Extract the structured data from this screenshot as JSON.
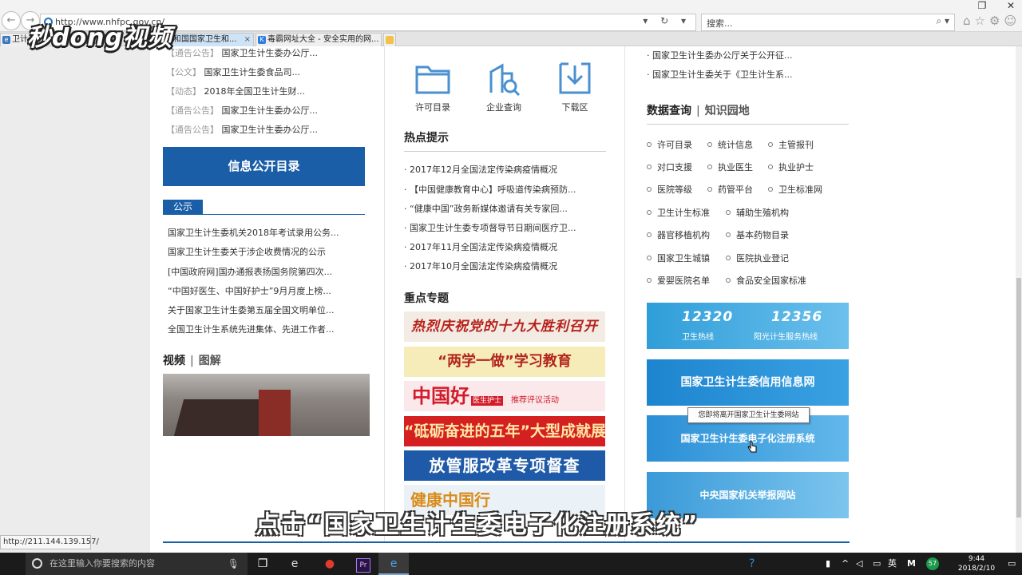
{
  "browser": {
    "url": "http://www.nhfpc.gov.cn/",
    "search_placeholder": "搜索...",
    "tabs": [
      {
        "label": "卫计..."
      },
      {
        "label": "共和国国家卫生和..."
      },
      {
        "label": "毒霸网址大全 - 安全实用的网..."
      }
    ]
  },
  "watermark_logo": "秒dong视频",
  "left_column": {
    "top_items": [
      {
        "tag": "【通告公告】",
        "text": "国家卫生计生委办公厅..."
      },
      {
        "tag": "【公文】",
        "text": "国家卫生计生委食品司..."
      },
      {
        "tag": "【动态】",
        "text": "2018年全国卫生计生财..."
      },
      {
        "tag": "【通告公告】",
        "text": "国家卫生计生委办公厅..."
      },
      {
        "tag": "【通告公告】",
        "text": "国家卫生计生委办公厅..."
      }
    ],
    "catalog_button": "信息公开目录",
    "notice_tab": "公示",
    "notice_items": [
      "国家卫生计生委机关2018年考试录用公务...",
      "国家卫生计生委关于涉企收费情况的公示",
      "[中国政府网]国办通报表扬国务院第四次...",
      "“中国好医生、中国好护士”9月月度上榜...",
      "关于国家卫生计生委第五届全国文明单位...",
      "全国卫生计生系统先进集体、先进工作者..."
    ],
    "video_head": "视频",
    "video_sub": "图解"
  },
  "middle_column": {
    "quick_links": [
      {
        "label": "许可目录"
      },
      {
        "label": "企业查询"
      },
      {
        "label": "下载区"
      }
    ],
    "hot_head": "热点提示",
    "hot_items": [
      "2017年12月全国法定传染病疫情概况",
      "【中国健康教育中心】呼吸道传染病预防...",
      "“健康中国”政务新媒体邀请有关专家回...",
      "国家卫生计生委专项督导节日期间医疗卫...",
      "2017年11月全国法定传染病疫情概况",
      "2017年10月全国法定传染病疫情概况"
    ],
    "topics_head": "重点专题",
    "banners": [
      "热烈庆祝党的十九大胜利召开",
      "“两学一做”学习教育",
      "中国好",
      "“砥砺奋进的五年”大型成就展",
      "放管服改革专项督查",
      "健康中国行"
    ],
    "banner3_badge": "医生护士",
    "banner3_small": "推荐评议活动"
  },
  "right_column": {
    "top_items": [
      "国家卫生计生委办公厅关于公开征...",
      "国家卫生计生委关于《卫生计生系..."
    ],
    "data_head": "数据查询",
    "data_sub": "知识园地",
    "query_links": [
      "许可目录",
      "统计信息",
      "主管报刊",
      "对口支援",
      "执业医生",
      "执业护士",
      "医院等级",
      "药管平台",
      "卫生标准网",
      "卫生计生标准",
      "辅助生殖机构",
      "器官移植机构",
      "基本药物目录",
      "国家卫生城镇",
      "医院执业登记",
      "爱婴医院名单",
      "食品安全国家标准"
    ],
    "hotline_a_num": "12320",
    "hotline_a_label": "卫生热线",
    "hotline_b_num": "12356",
    "hotline_b_label": "阳光计生服务热线",
    "credit_banner": "国家卫生计生委信用信息网",
    "ereg_banner": "国家卫生计生委电子化注册系统",
    "report_banner": "中央国家机关举报网站",
    "tooltip": "您即将离开国家卫生计生委网站"
  },
  "status_url": "http://211.144.139.157/",
  "subtitle": "点击“国家卫生计生委电子化注册系统”",
  "taskbar": {
    "search_placeholder": "在这里输入你要搜索的内容",
    "tray_lang": "英",
    "tray_badge": "57",
    "time": "9:44",
    "date": "2018/2/10"
  },
  "colors": {
    "brand_blue": "#1b5ea8",
    "hotline_blue": "#2f9ed9"
  }
}
